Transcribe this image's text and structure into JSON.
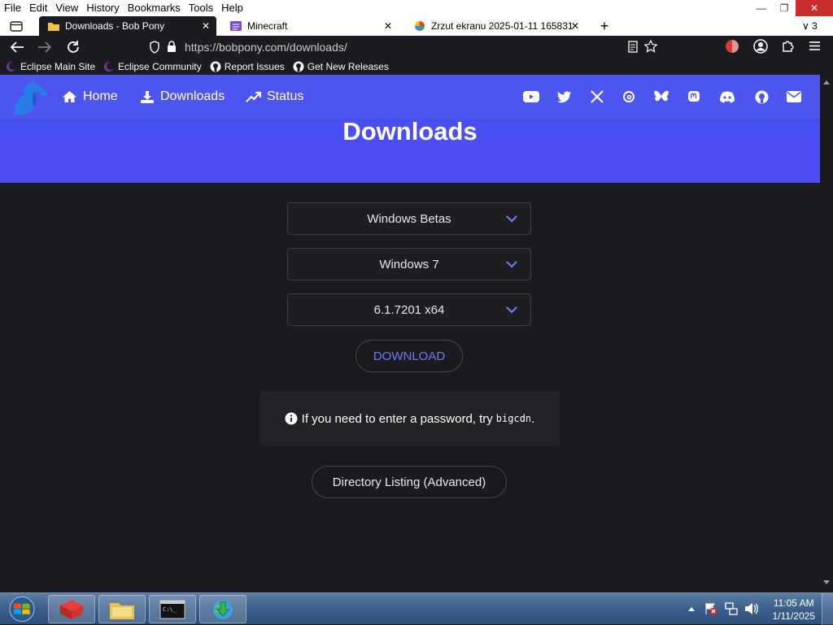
{
  "menu": [
    "File",
    "Edit",
    "View",
    "History",
    "Bookmarks",
    "Tools",
    "Help"
  ],
  "tabs": [
    {
      "title": "Downloads - Bob Pony",
      "active": true
    },
    {
      "title": "Minecraft",
      "active": false
    },
    {
      "title": "Zrzut ekranu 2025-01-11 165831",
      "active": false
    }
  ],
  "tab_count": "3",
  "url": "https://bobpony.com/downloads/",
  "bookmarks": [
    "Eclipse Main Site",
    "Eclipse Community",
    "Report Issues",
    "Get New Releases"
  ],
  "site_nav": {
    "home": "Home",
    "downloads": "Downloads",
    "status": "Status"
  },
  "social_icons": [
    "youtube-icon",
    "twitter-icon",
    "x-icon",
    "threads-icon",
    "bluesky-icon",
    "mastodon-icon",
    "discord-icon",
    "github-icon",
    "email-icon"
  ],
  "page_title": "Downloads",
  "selects": {
    "category": "Windows Betas",
    "os": "Windows 7",
    "build": "6.1.7201 x64"
  },
  "download_button": "DOWNLOAD",
  "note": {
    "text": "If you need to enter a password, try",
    "code": "bigcdn",
    "suffix": "."
  },
  "directory_button": "Directory Listing (Advanced)",
  "clock": {
    "time": "11:05 AM",
    "date": "1/11/2025"
  },
  "colors": {
    "accent": "#4f56ef",
    "link": "#6e7cf4",
    "background": "#1b1b1f"
  }
}
